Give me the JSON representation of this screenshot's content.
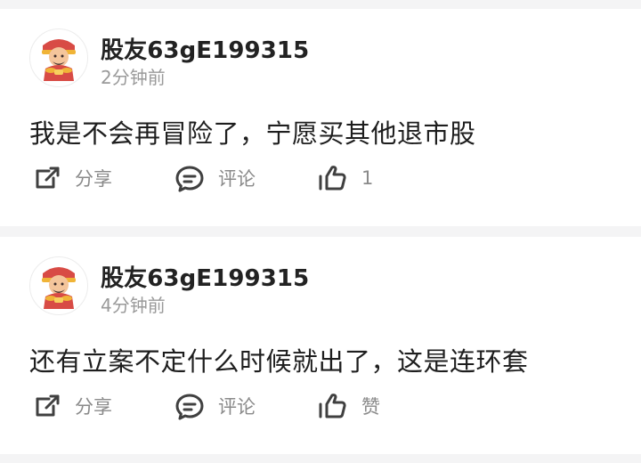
{
  "posts": [
    {
      "user": "股友63gE199315",
      "time": "2分钟前",
      "content": "我是不会再冒险了，宁愿买其他退市股",
      "actions": {
        "share": "分享",
        "comment": "评论",
        "like": "1"
      }
    },
    {
      "user": "股友63gE199315",
      "time": "4分钟前",
      "content": "还有立案不定什么时候就出了，这是连环套",
      "actions": {
        "share": "分享",
        "comment": "评论",
        "like": "赞"
      }
    }
  ],
  "icons": {
    "avatar": "god-of-wealth-avatar",
    "share": "share-icon",
    "comment": "comment-icon",
    "like": "thumbs-up-icon"
  }
}
